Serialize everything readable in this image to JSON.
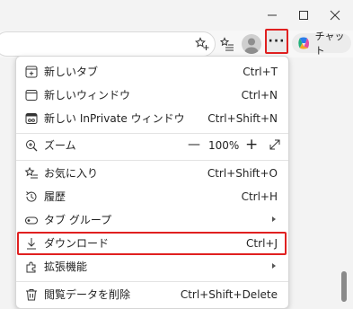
{
  "window_controls": {
    "minimize": "minimize-icon",
    "maximize": "maximize-icon",
    "close": "close-icon"
  },
  "toolbar": {
    "copilot_label": "チャット",
    "more_label": "···"
  },
  "menu": {
    "items": [
      {
        "label": "新しいタブ",
        "shortcut": "Ctrl+T",
        "icon": "new-tab-icon"
      },
      {
        "label": "新しいウィンドウ",
        "shortcut": "Ctrl+N",
        "icon": "new-window-icon"
      },
      {
        "label": "新しい InPrivate ウィンドウ",
        "shortcut": "Ctrl+Shift+N",
        "icon": "inprivate-icon"
      },
      {
        "label": "ズーム",
        "icon": "zoom-icon",
        "zoom_minus": "—",
        "zoom_value": "100%",
        "zoom_plus": "+"
      },
      {
        "label": "お気に入り",
        "shortcut": "Ctrl+Shift+O",
        "icon": "favorites-icon"
      },
      {
        "label": "履歴",
        "shortcut": "Ctrl+H",
        "icon": "history-icon"
      },
      {
        "label": "タブ グループ",
        "icon": "tab-groups-icon",
        "submenu": true
      },
      {
        "label": "ダウンロード",
        "shortcut": "Ctrl+J",
        "icon": "download-icon",
        "highlighted": true
      },
      {
        "label": "拡張機能",
        "icon": "extensions-icon",
        "submenu": true
      },
      {
        "label": "閲覧データを削除",
        "shortcut": "Ctrl+Shift+Delete",
        "icon": "delete-icon"
      }
    ]
  },
  "colors": {
    "highlight": "#e02020",
    "menu_bg": "#ffffff",
    "chrome_bg": "#f3f3f3"
  }
}
